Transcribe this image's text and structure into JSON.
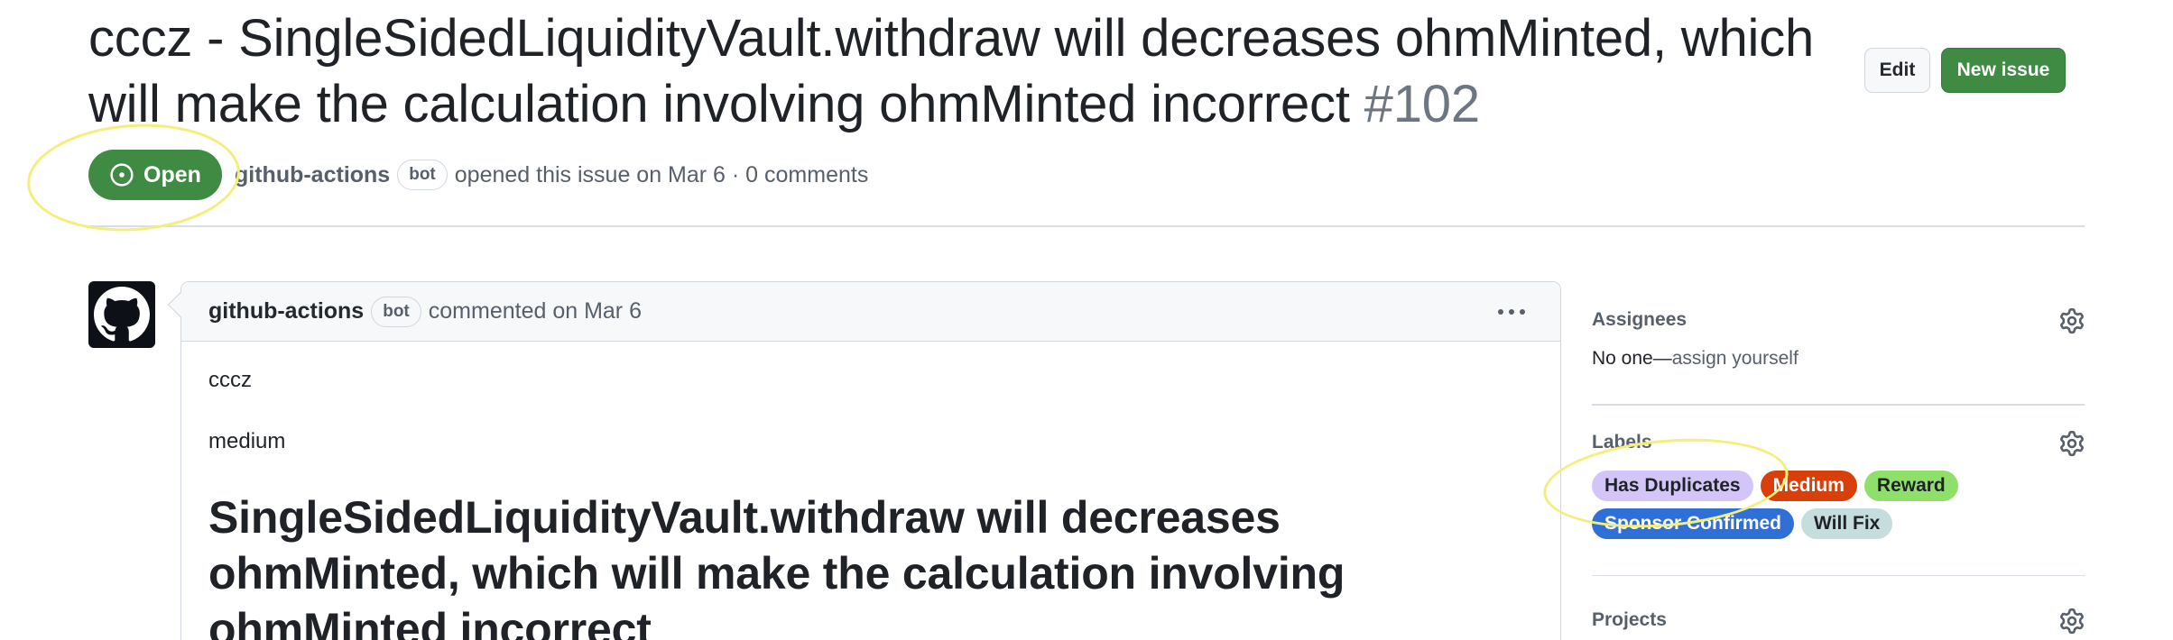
{
  "issue": {
    "title": "cccz - SingleSidedLiquidityVault.withdraw will decreases ohmMinted, which will make the calculation involving ohmMinted incorrect",
    "number": "#102",
    "state": "Open",
    "author": "github-actions",
    "author_badge": "bot",
    "meta": "opened this issue on Mar 6 · 0 comments"
  },
  "header_actions": {
    "edit_label": "Edit",
    "new_issue_label": "New issue"
  },
  "comment": {
    "author": "github-actions",
    "author_badge": "bot",
    "action": "commented on Mar 6",
    "body": {
      "line1": "cccz",
      "line2": "medium",
      "heading": "SingleSidedLiquidityVault.withdraw will decreases ohmMinted, which will make the calculation involving ohmMinted incorrect"
    }
  },
  "sidebar": {
    "assignees": {
      "title": "Assignees",
      "value_prefix": "No one—",
      "value_link": "assign yourself"
    },
    "labels": {
      "title": "Labels",
      "items": [
        {
          "name": "Has Duplicates",
          "bg": "#d4c5f9",
          "fg": "#1f2328"
        },
        {
          "name": "Medium",
          "bg": "#d93f0b",
          "fg": "#ffffff"
        },
        {
          "name": "Reward",
          "bg": "#8fe06a",
          "fg": "#1f2328"
        },
        {
          "name": "Sponsor Confirmed",
          "bg": "#2f6fd6",
          "fg": "#ffffff"
        },
        {
          "name": "Will Fix",
          "bg": "#c5dedd",
          "fg": "#1f2328"
        }
      ]
    },
    "projects": {
      "title": "Projects"
    }
  },
  "colors": {
    "open_green": "#3f8b43",
    "annotation_yellow": "#f2ef7a"
  },
  "icons": {
    "state": "issue-opened-icon",
    "avatar": "github-mark-icon",
    "menu": "kebab-horizontal-icon",
    "settings": "gear-icon"
  }
}
